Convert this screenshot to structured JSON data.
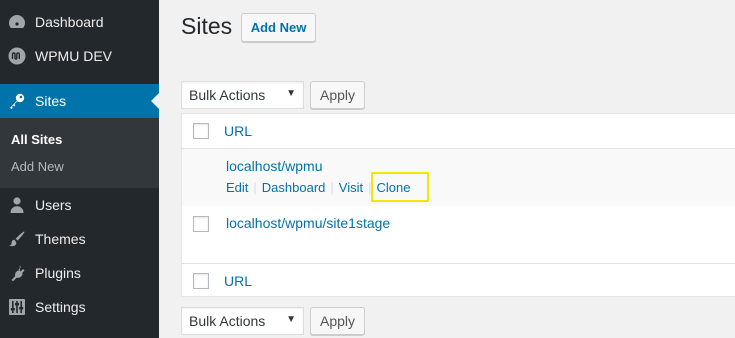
{
  "sidebar": {
    "dashboard": "Dashboard",
    "wpmu": "WPMU DEV",
    "sites": "Sites",
    "submenu": {
      "all_sites": "All Sites",
      "add_new": "Add New"
    },
    "users": "Users",
    "themes": "Themes",
    "plugins": "Plugins",
    "settings": "Settings"
  },
  "header": {
    "title": "Sites",
    "add_new": "Add New"
  },
  "bulk": {
    "label": "Bulk Actions",
    "apply": "Apply"
  },
  "table": {
    "column": "URL",
    "rows": [
      {
        "url": "localhost/wpmu",
        "actions": [
          "Edit",
          "Dashboard",
          "Visit",
          "Clone"
        ]
      },
      {
        "url": "localhost/wpmu/site1stage"
      }
    ]
  },
  "colors": {
    "sidebar_bg": "#23282d",
    "active": "#0073aa",
    "link": "#0073aa",
    "highlight": "#f2e900"
  }
}
